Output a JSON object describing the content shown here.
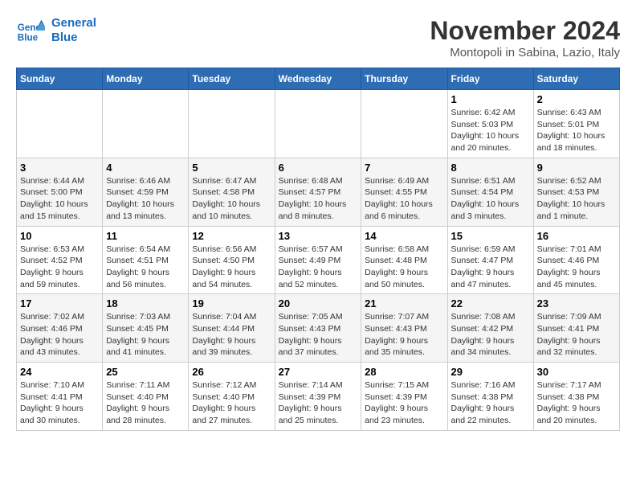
{
  "logo": {
    "line1": "General",
    "line2": "Blue"
  },
  "title": "November 2024",
  "subtitle": "Montopoli in Sabina, Lazio, Italy",
  "days_of_week": [
    "Sunday",
    "Monday",
    "Tuesday",
    "Wednesday",
    "Thursday",
    "Friday",
    "Saturday"
  ],
  "weeks": [
    [
      {
        "day": "",
        "info": ""
      },
      {
        "day": "",
        "info": ""
      },
      {
        "day": "",
        "info": ""
      },
      {
        "day": "",
        "info": ""
      },
      {
        "day": "",
        "info": ""
      },
      {
        "day": "1",
        "info": "Sunrise: 6:42 AM\nSunset: 5:03 PM\nDaylight: 10 hours and 20 minutes."
      },
      {
        "day": "2",
        "info": "Sunrise: 6:43 AM\nSunset: 5:01 PM\nDaylight: 10 hours and 18 minutes."
      }
    ],
    [
      {
        "day": "3",
        "info": "Sunrise: 6:44 AM\nSunset: 5:00 PM\nDaylight: 10 hours and 15 minutes."
      },
      {
        "day": "4",
        "info": "Sunrise: 6:46 AM\nSunset: 4:59 PM\nDaylight: 10 hours and 13 minutes."
      },
      {
        "day": "5",
        "info": "Sunrise: 6:47 AM\nSunset: 4:58 PM\nDaylight: 10 hours and 10 minutes."
      },
      {
        "day": "6",
        "info": "Sunrise: 6:48 AM\nSunset: 4:57 PM\nDaylight: 10 hours and 8 minutes."
      },
      {
        "day": "7",
        "info": "Sunrise: 6:49 AM\nSunset: 4:55 PM\nDaylight: 10 hours and 6 minutes."
      },
      {
        "day": "8",
        "info": "Sunrise: 6:51 AM\nSunset: 4:54 PM\nDaylight: 10 hours and 3 minutes."
      },
      {
        "day": "9",
        "info": "Sunrise: 6:52 AM\nSunset: 4:53 PM\nDaylight: 10 hours and 1 minute."
      }
    ],
    [
      {
        "day": "10",
        "info": "Sunrise: 6:53 AM\nSunset: 4:52 PM\nDaylight: 9 hours and 59 minutes."
      },
      {
        "day": "11",
        "info": "Sunrise: 6:54 AM\nSunset: 4:51 PM\nDaylight: 9 hours and 56 minutes."
      },
      {
        "day": "12",
        "info": "Sunrise: 6:56 AM\nSunset: 4:50 PM\nDaylight: 9 hours and 54 minutes."
      },
      {
        "day": "13",
        "info": "Sunrise: 6:57 AM\nSunset: 4:49 PM\nDaylight: 9 hours and 52 minutes."
      },
      {
        "day": "14",
        "info": "Sunrise: 6:58 AM\nSunset: 4:48 PM\nDaylight: 9 hours and 50 minutes."
      },
      {
        "day": "15",
        "info": "Sunrise: 6:59 AM\nSunset: 4:47 PM\nDaylight: 9 hours and 47 minutes."
      },
      {
        "day": "16",
        "info": "Sunrise: 7:01 AM\nSunset: 4:46 PM\nDaylight: 9 hours and 45 minutes."
      }
    ],
    [
      {
        "day": "17",
        "info": "Sunrise: 7:02 AM\nSunset: 4:46 PM\nDaylight: 9 hours and 43 minutes."
      },
      {
        "day": "18",
        "info": "Sunrise: 7:03 AM\nSunset: 4:45 PM\nDaylight: 9 hours and 41 minutes."
      },
      {
        "day": "19",
        "info": "Sunrise: 7:04 AM\nSunset: 4:44 PM\nDaylight: 9 hours and 39 minutes."
      },
      {
        "day": "20",
        "info": "Sunrise: 7:05 AM\nSunset: 4:43 PM\nDaylight: 9 hours and 37 minutes."
      },
      {
        "day": "21",
        "info": "Sunrise: 7:07 AM\nSunset: 4:43 PM\nDaylight: 9 hours and 35 minutes."
      },
      {
        "day": "22",
        "info": "Sunrise: 7:08 AM\nSunset: 4:42 PM\nDaylight: 9 hours and 34 minutes."
      },
      {
        "day": "23",
        "info": "Sunrise: 7:09 AM\nSunset: 4:41 PM\nDaylight: 9 hours and 32 minutes."
      }
    ],
    [
      {
        "day": "24",
        "info": "Sunrise: 7:10 AM\nSunset: 4:41 PM\nDaylight: 9 hours and 30 minutes."
      },
      {
        "day": "25",
        "info": "Sunrise: 7:11 AM\nSunset: 4:40 PM\nDaylight: 9 hours and 28 minutes."
      },
      {
        "day": "26",
        "info": "Sunrise: 7:12 AM\nSunset: 4:40 PM\nDaylight: 9 hours and 27 minutes."
      },
      {
        "day": "27",
        "info": "Sunrise: 7:14 AM\nSunset: 4:39 PM\nDaylight: 9 hours and 25 minutes."
      },
      {
        "day": "28",
        "info": "Sunrise: 7:15 AM\nSunset: 4:39 PM\nDaylight: 9 hours and 23 minutes."
      },
      {
        "day": "29",
        "info": "Sunrise: 7:16 AM\nSunset: 4:38 PM\nDaylight: 9 hours and 22 minutes."
      },
      {
        "day": "30",
        "info": "Sunrise: 7:17 AM\nSunset: 4:38 PM\nDaylight: 9 hours and 20 minutes."
      }
    ]
  ]
}
